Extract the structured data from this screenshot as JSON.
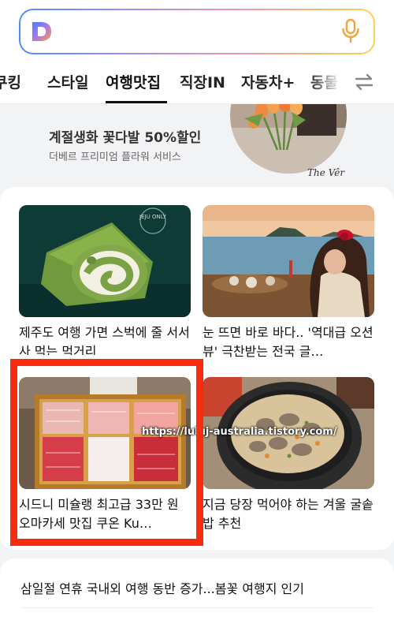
{
  "search": {
    "placeholder": ""
  },
  "tabs": [
    {
      "label": "쿠킹"
    },
    {
      "label": "스타일"
    },
    {
      "label": "여행맛집",
      "active": true
    },
    {
      "label": "직장IN"
    },
    {
      "label": "자동차+"
    },
    {
      "label": "동물"
    }
  ],
  "ad": {
    "title": "계절생화 꽃다발 50%할인",
    "subtitle": "더베르 프리미엄 플라워 서비스",
    "brand": "The Vêr"
  },
  "cards": [
    {
      "caption": "제주도 여행 가면 스벅에 줄 서서 사 먹는 먹거리",
      "badge": "JEJU ONLY"
    },
    {
      "caption": "눈 뜨면 바로 바다.. '역대급 오션뷰' 극찬받는 전국 글…"
    },
    {
      "caption": "시드니 미슐랭 최고급 33만 원 오마카세 맛집 쿠온 Ku…"
    },
    {
      "caption": "지금 당장 먹어야 하는 겨울 굴솥밥 추천"
    }
  ],
  "watermark": "https://luluj-australia.tistory.com/",
  "news": [
    {
      "title": "삼일절 연휴 국내외 여행 동반 증가...봄꽃 여행지 인기"
    }
  ],
  "colors": {
    "highlight_box": "#f72b0d",
    "active_tab_underline": "#111111"
  }
}
